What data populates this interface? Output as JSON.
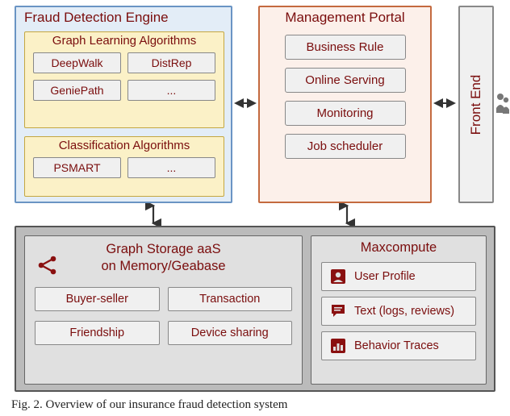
{
  "fraud_engine": {
    "title": "Fraud Detection Engine",
    "graph_algos": {
      "title": "Graph Learning Algorithms",
      "items": [
        "DeepWalk",
        "DistRep",
        "GeniePath",
        "..."
      ]
    },
    "class_algos": {
      "title": "Classification Algorithms",
      "items": [
        "PSMART",
        "..."
      ]
    }
  },
  "mgmt": {
    "title": "Management Portal",
    "items": [
      "Business Rule",
      "Online Serving",
      "Monitoring",
      "Job scheduler"
    ]
  },
  "frontend": {
    "title": "Front End"
  },
  "storage": {
    "graph_storage": {
      "line1": "Graph Storage aaS",
      "line2": "on Memory/Geabase",
      "items": [
        "Buyer-seller",
        "Transaction",
        "Friendship",
        "Device sharing"
      ]
    },
    "maxcompute": {
      "title": "Maxcompute",
      "items": [
        "User Profile",
        "Text (logs, reviews)",
        "Behavior Traces"
      ]
    }
  },
  "caption": "Fig. 2. Overview of our insurance fraud detection system",
  "icons": {
    "share": "share-icon",
    "user": "user-profile-icon",
    "chat": "chat-icon",
    "bar": "bar-chart-icon",
    "people": "people-icon"
  },
  "colors": {
    "fraud_bg": "#e3edf7",
    "fraud_border": "#6a94c4",
    "algo_bg": "#fbf1c7",
    "algo_border": "#c4a741",
    "mgmt_bg": "#fcf0ea",
    "mgmt_border": "#c46a3f",
    "storage_outer": "#bbbbbb",
    "storage_inner": "#e0e0e0",
    "text": "#7a0d0d",
    "icon": "#8a1010"
  }
}
